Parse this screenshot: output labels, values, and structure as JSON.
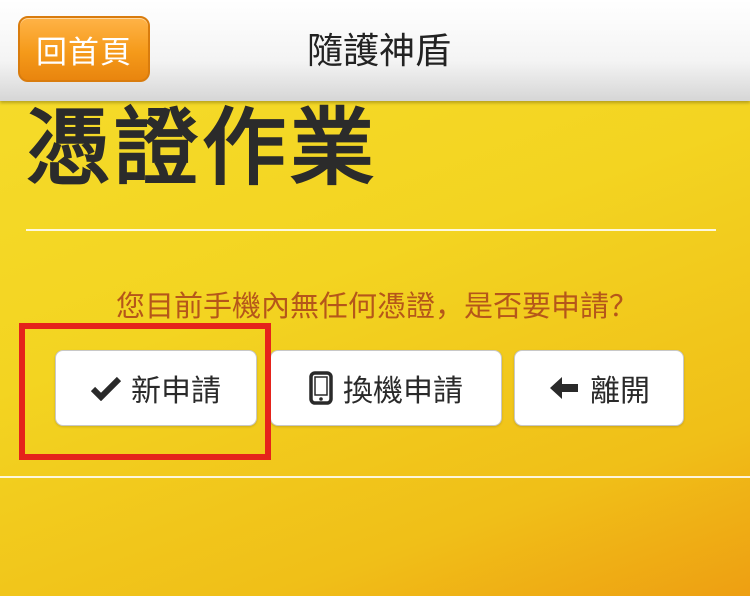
{
  "header": {
    "home_label": "回首頁",
    "title": "隨護神盾"
  },
  "main": {
    "page_title": "憑證作業",
    "prompt": "您目前手機內無任何憑證，是否要申請？",
    "buttons": {
      "new_apply": {
        "label": "新申請",
        "icon": "check-icon"
      },
      "switch_device": {
        "label": "換機申請",
        "icon": "mobile-phone-icon"
      },
      "leave": {
        "label": "離開",
        "icon": "arrow-left-icon"
      }
    }
  },
  "colors": {
    "background": "#f3d421",
    "home_button": "#f59a1a",
    "prompt_text": "#b5561a",
    "highlight_box": "#e5231b"
  }
}
